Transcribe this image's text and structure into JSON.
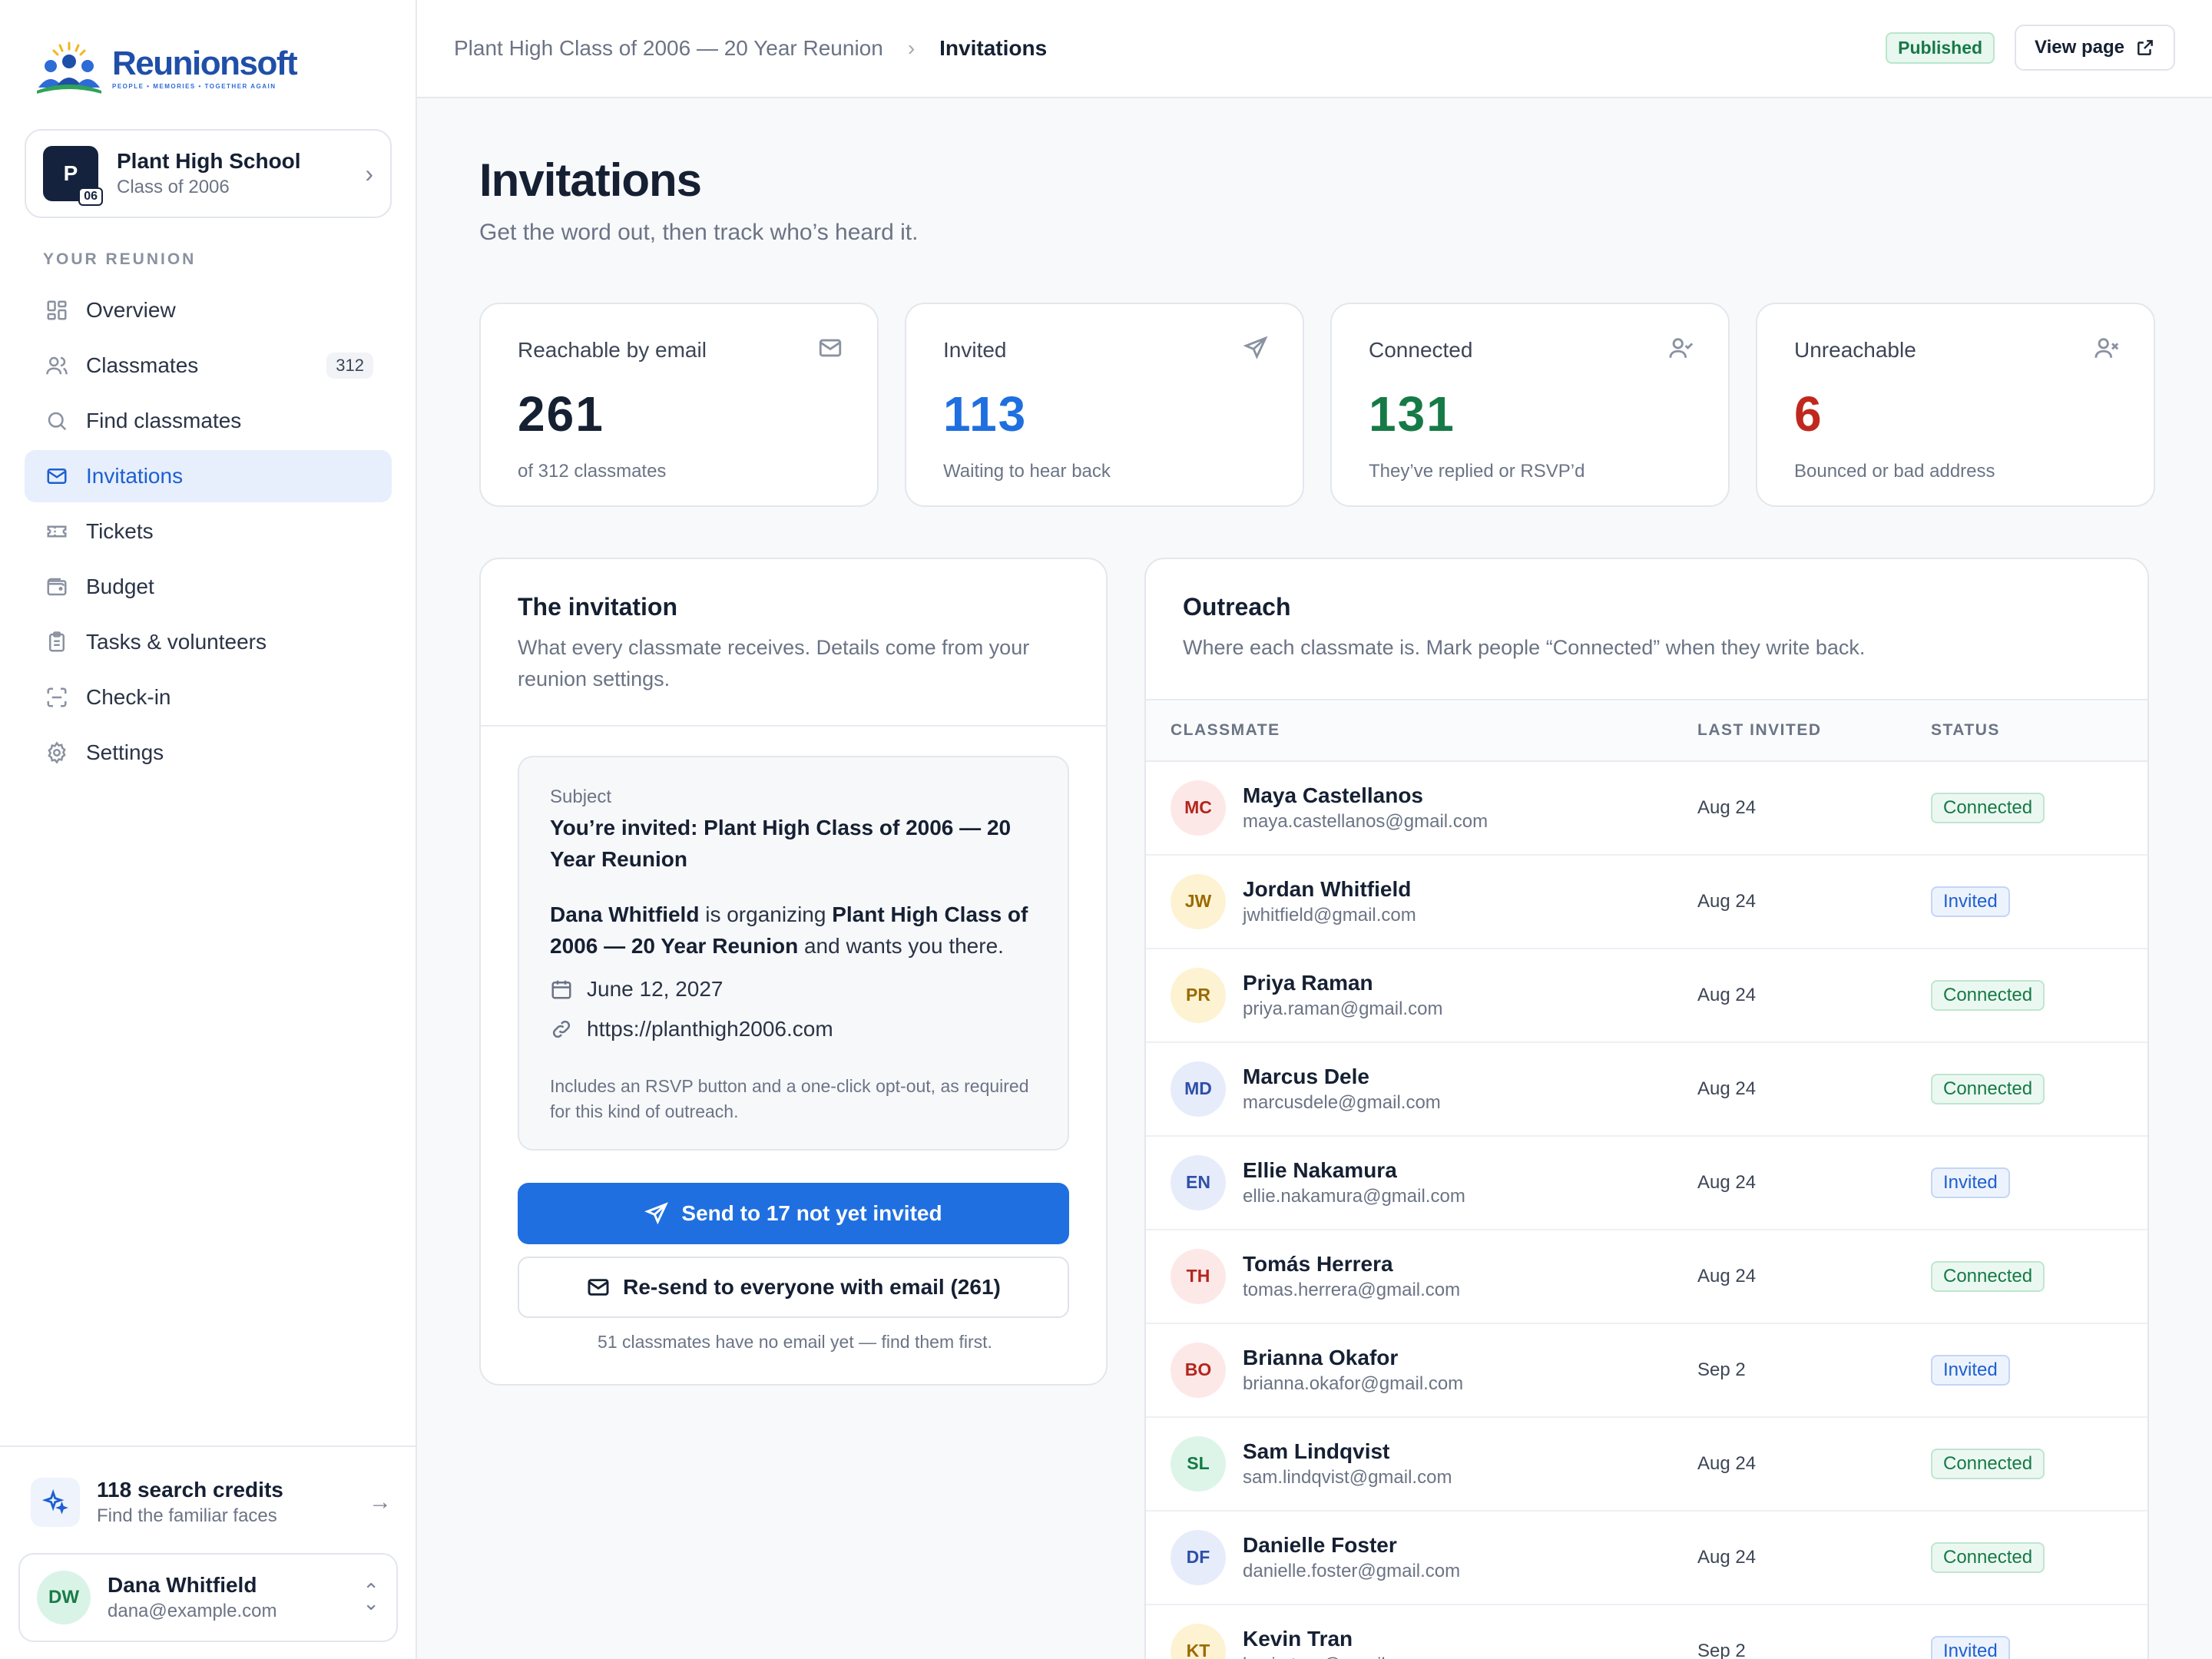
{
  "brand": {
    "name": "Reunionsoft",
    "tagline": "PEOPLE • MEMORIES • TOGETHER AGAIN"
  },
  "school": {
    "initial": "P",
    "badge": "06",
    "name": "Plant High School",
    "class": "Class of 2006"
  },
  "nav": {
    "section": "YOUR REUNION",
    "items": [
      {
        "label": "Overview",
        "icon": "grid-icon"
      },
      {
        "label": "Classmates",
        "icon": "people-icon",
        "count": "312"
      },
      {
        "label": "Find classmates",
        "icon": "search-icon"
      },
      {
        "label": "Invitations",
        "icon": "mail-icon"
      },
      {
        "label": "Tickets",
        "icon": "ticket-icon"
      },
      {
        "label": "Budget",
        "icon": "wallet-icon"
      },
      {
        "label": "Tasks & volunteers",
        "icon": "clipboard-icon"
      },
      {
        "label": "Check-in",
        "icon": "scan-icon"
      },
      {
        "label": "Settings",
        "icon": "gear-icon"
      }
    ]
  },
  "credits": {
    "title": "118 search credits",
    "sub": "Find the familiar faces"
  },
  "user": {
    "initials": "DW",
    "name": "Dana Whitfield",
    "email": "dana@example.com"
  },
  "topbar": {
    "crumb_parent": "Plant High Class of 2006 — 20 Year Reunion",
    "crumb_current": "Invitations",
    "status": "Published",
    "view_label": "View page"
  },
  "page": {
    "title": "Invitations",
    "subtitle": "Get the word out, then track who’s heard it."
  },
  "stats": [
    {
      "label": "Reachable by email",
      "value": "261",
      "sub": "of 312 classmates",
      "color": "#162033",
      "icon": "mail-icon"
    },
    {
      "label": "Invited",
      "value": "113",
      "sub": "Waiting to hear back",
      "color": "#1f6fe0",
      "icon": "send-icon"
    },
    {
      "label": "Connected",
      "value": "131",
      "sub": "They’ve replied or RSVP’d",
      "color": "#167a46",
      "icon": "user-check-icon"
    },
    {
      "label": "Unreachable",
      "value": "6",
      "sub": "Bounced or bad address",
      "color": "#c0281e",
      "icon": "user-x-icon"
    }
  ],
  "invitation": {
    "title": "The invitation",
    "desc": "What every classmate receives. Details come from your reunion settings.",
    "subject_label": "Subject",
    "subject": "You’re invited: Plant High Class of 2006 — 20 Year Reunion",
    "organizer": "Dana Whitfield",
    "body_mid": " is organizing ",
    "event": "Plant High Class of 2006 — 20 Year Reunion",
    "body_end": " and wants you there.",
    "date": "June 12, 2027",
    "url": "https://planthigh2006.com",
    "fine": "Includes an RSVP button and a one-click opt-out, as required for this kind of outreach.",
    "send_label": "Send to 17 not yet invited",
    "resend_label": "Re-send to everyone with email (261)",
    "note": "51 classmates have no email yet — find them first."
  },
  "outreach": {
    "title": "Outreach",
    "desc": "Where each classmate is. Mark people “Connected” when they write back.",
    "columns": {
      "name": "CLASSMATE",
      "date": "LAST INVITED",
      "status": "STATUS"
    },
    "rows": [
      {
        "initials": "MC",
        "name": "Maya Castellanos",
        "email": "maya.castellanos@gmail.com",
        "date": "Aug 24",
        "status": "Connected",
        "bg": "#fde8e8",
        "fg": "#b3261e"
      },
      {
        "initials": "JW",
        "name": "Jordan Whitfield",
        "email": "jwhitfield@gmail.com",
        "date": "Aug 24",
        "status": "Invited",
        "bg": "#fdf3d3",
        "fg": "#9a6a00"
      },
      {
        "initials": "PR",
        "name": "Priya Raman",
        "email": "priya.raman@gmail.com",
        "date": "Aug 24",
        "status": "Connected",
        "bg": "#fdf3d3",
        "fg": "#9a6a00"
      },
      {
        "initials": "MD",
        "name": "Marcus Dele",
        "email": "marcusdele@gmail.com",
        "date": "Aug 24",
        "status": "Connected",
        "bg": "#e7ecfb",
        "fg": "#2e4fa8"
      },
      {
        "initials": "EN",
        "name": "Ellie Nakamura",
        "email": "ellie.nakamura@gmail.com",
        "date": "Aug 24",
        "status": "Invited",
        "bg": "#e7ecfb",
        "fg": "#2e4fa8"
      },
      {
        "initials": "TH",
        "name": "Tomás Herrera",
        "email": "tomas.herrera@gmail.com",
        "date": "Aug 24",
        "status": "Connected",
        "bg": "#fde8e8",
        "fg": "#b3261e"
      },
      {
        "initials": "BO",
        "name": "Brianna Okafor",
        "email": "brianna.okafor@gmail.com",
        "date": "Sep 2",
        "status": "Invited",
        "bg": "#fde8e8",
        "fg": "#b3261e"
      },
      {
        "initials": "SL",
        "name": "Sam Lindqvist",
        "email": "sam.lindqvist@gmail.com",
        "date": "Aug 24",
        "status": "Connected",
        "bg": "#dcf5e8",
        "fg": "#167a46"
      },
      {
        "initials": "DF",
        "name": "Danielle Foster",
        "email": "danielle.foster@gmail.com",
        "date": "Aug 24",
        "status": "Connected",
        "bg": "#e7ecfb",
        "fg": "#2e4fa8"
      },
      {
        "initials": "KT",
        "name": "Kevin Tran",
        "email": "kevin.tran@gmail.com",
        "date": "Sep 2",
        "status": "Invited",
        "bg": "#fdf3d3",
        "fg": "#9a6a00"
      }
    ]
  }
}
